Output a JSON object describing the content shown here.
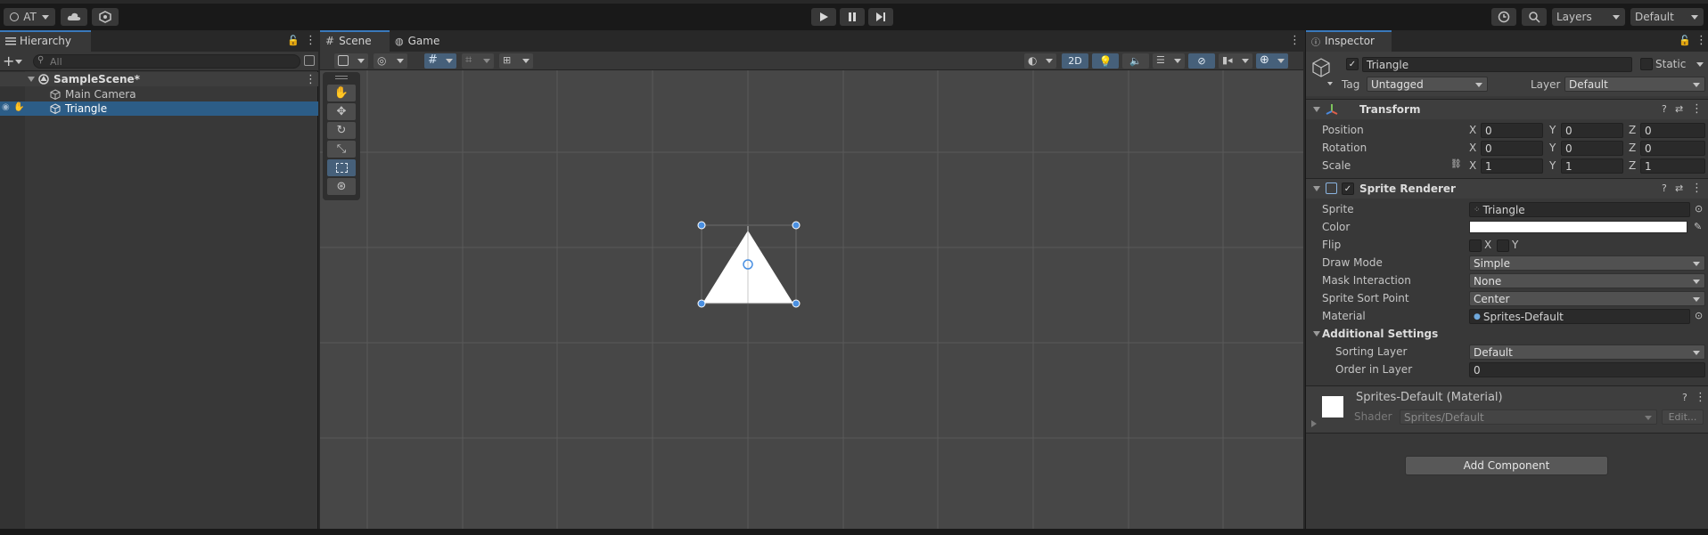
{
  "toolbar": {
    "account_label": "AT",
    "layers_label": "Layers",
    "layout_label": "Default"
  },
  "hierarchy": {
    "tab_label": "Hierarchy",
    "search_placeholder": "All",
    "scene_name": "SampleScene*",
    "items": [
      {
        "label": "Main Camera"
      },
      {
        "label": "Triangle",
        "selected": true
      }
    ]
  },
  "scene": {
    "tabs": [
      {
        "label": "Scene"
      },
      {
        "label": "Game"
      }
    ],
    "toolbar_2d_label": "2D"
  },
  "inspector": {
    "tab_label": "Inspector",
    "object_name": "Triangle",
    "static_label": "Static",
    "tag_label": "Tag",
    "tag_value": "Untagged",
    "layer_label": "Layer",
    "layer_value": "Default",
    "transform": {
      "title": "Transform",
      "position": {
        "label": "Position",
        "x": "0",
        "y": "0",
        "z": "0"
      },
      "rotation": {
        "label": "Rotation",
        "x": "0",
        "y": "0",
        "z": "0"
      },
      "scale": {
        "label": "Scale",
        "x": "1",
        "y": "1",
        "z": "1"
      }
    },
    "axes": {
      "x": "X",
      "y": "Y",
      "z": "Z"
    },
    "sprite_renderer": {
      "title": "Sprite Renderer",
      "sprite_label": "Sprite",
      "sprite_value": "Triangle",
      "color_label": "Color",
      "color_value": "#ffffff",
      "flip_label": "Flip",
      "flip_x": "X",
      "flip_y": "Y",
      "draw_mode_label": "Draw Mode",
      "draw_mode_value": "Simple",
      "mask_label": "Mask Interaction",
      "mask_value": "None",
      "sort_point_label": "Sprite Sort Point",
      "sort_point_value": "Center",
      "material_label": "Material",
      "material_value": "Sprites-Default",
      "additional_label": "Additional Settings",
      "sorting_layer_label": "Sorting Layer",
      "sorting_layer_value": "Default",
      "order_label": "Order in Layer",
      "order_value": "0"
    },
    "material": {
      "title": "Sprites-Default (Material)",
      "shader_label": "Shader",
      "shader_value": "Sprites/Default",
      "edit_label": "Edit..."
    },
    "add_component_label": "Add Component"
  },
  "colors": {
    "selection": "#2c5d87",
    "accent": "#3a79bb",
    "handle": "#4a90e2"
  }
}
